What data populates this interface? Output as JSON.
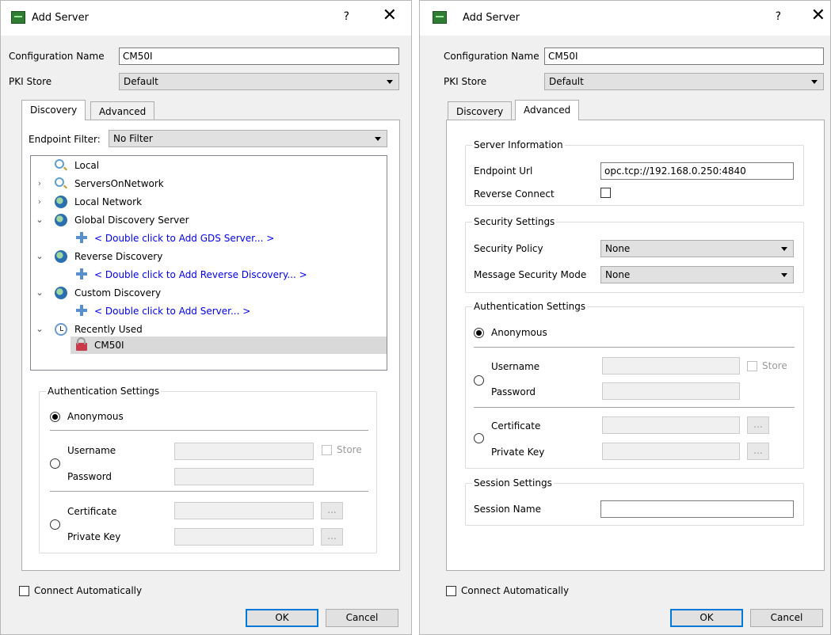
{
  "left_dialog": {
    "title": "Add Server",
    "help_label": "?",
    "close_label": "✕",
    "config_name_label": "Configuration Name",
    "config_name_value": "CM50I",
    "pki_store_label": "PKI Store",
    "pki_store_value": "Default",
    "tabs": [
      {
        "label": "Discovery",
        "active": true
      },
      {
        "label": "Advanced",
        "active": false
      }
    ],
    "endpoint_filter_label": "Endpoint Filter:",
    "endpoint_filter_value": "No Filter",
    "tree": [
      {
        "label": "Local",
        "icon": "search-icon",
        "expander": "",
        "indent": 0,
        "link": false
      },
      {
        "label": "ServersOnNetwork",
        "icon": "search-icon",
        "expander": "›",
        "indent": 0,
        "link": false
      },
      {
        "label": "Local Network",
        "icon": "globe-icon",
        "expander": "›",
        "indent": 0,
        "link": false
      },
      {
        "label": "Global Discovery Server",
        "icon": "globe-icon",
        "expander": "⌄",
        "indent": 0,
        "link": false
      },
      {
        "label": "< Double click to Add GDS Server... >",
        "icon": "plus-icon",
        "expander": "",
        "indent": 1,
        "link": true
      },
      {
        "label": "Reverse Discovery",
        "icon": "globe-icon",
        "expander": "⌄",
        "indent": 0,
        "link": false
      },
      {
        "label": "< Double click to Add Reverse Discovery... >",
        "icon": "plus-icon",
        "expander": "",
        "indent": 1,
        "link": true
      },
      {
        "label": "Custom Discovery",
        "icon": "globe-icon",
        "expander": "⌄",
        "indent": 0,
        "link": false
      },
      {
        "label": "< Double click to Add Server... >",
        "icon": "plus-icon",
        "expander": "",
        "indent": 1,
        "link": true
      },
      {
        "label": "Recently Used",
        "icon": "clock-icon",
        "expander": "⌄",
        "indent": 0,
        "link": false
      },
      {
        "label": "CM50I",
        "icon": "lock-icon",
        "expander": "",
        "indent": 1,
        "link": false,
        "selected": true
      }
    ],
    "auth": {
      "title": "Authentication Settings",
      "anonymous": "Anonymous",
      "username": "Username",
      "password": "Password",
      "store": "Store",
      "certificate": "Certificate",
      "private_key": "Private Key",
      "browse": "..."
    },
    "connect_automatically": "Connect Automatically",
    "ok": "OK",
    "cancel": "Cancel"
  },
  "right_dialog": {
    "title": "Add Server",
    "help_label": "?",
    "close_label": "✕",
    "config_name_label": "Configuration Name",
    "config_name_value": "CM50I",
    "pki_store_label": "PKI Store",
    "pki_store_value": "Default",
    "tabs": [
      {
        "label": "Discovery",
        "active": false
      },
      {
        "label": "Advanced",
        "active": true
      }
    ],
    "server_info": {
      "title": "Server Information",
      "endpoint_url_label": "Endpoint Url",
      "endpoint_url_value": "opc.tcp://192.168.0.250:4840",
      "reverse_connect_label": "Reverse Connect"
    },
    "security": {
      "title": "Security Settings",
      "policy_label": "Security Policy",
      "policy_value": "None",
      "mode_label": "Message Security Mode",
      "mode_value": "None"
    },
    "auth": {
      "title": "Authentication Settings",
      "anonymous": "Anonymous",
      "username": "Username",
      "password": "Password",
      "store": "Store",
      "certificate": "Certificate",
      "private_key": "Private Key",
      "browse": "..."
    },
    "session": {
      "title": "Session Settings",
      "name_label": "Session Name",
      "name_value": ""
    },
    "connect_automatically": "Connect Automatically",
    "ok": "OK",
    "cancel": "Cancel"
  }
}
